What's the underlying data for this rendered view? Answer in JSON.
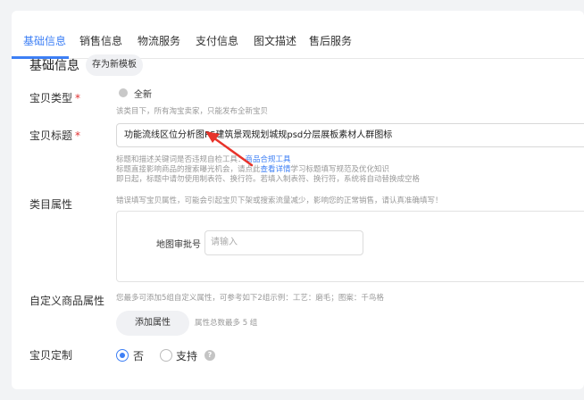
{
  "tabs": [
    {
      "label": "基础信息"
    },
    {
      "label": "销售信息"
    },
    {
      "label": "物流服务"
    },
    {
      "label": "支付信息"
    },
    {
      "label": "图文描述"
    },
    {
      "label": "售后服务"
    }
  ],
  "section": {
    "title": "基础信息",
    "save_template_label": "存为新模板"
  },
  "product_type": {
    "label": "宝贝类型",
    "required_mark": "*",
    "option_label": "全新",
    "tip": "该类目下，所有淘宝卖家，只能发布全新宝贝"
  },
  "product_title": {
    "label": "宝贝标题",
    "required_mark": "*",
    "value": "功能流线区位分析图PS建筑景观规划城规psd分层展板素材人群图标",
    "tip1_prefix": "标题和描述关键词是否违规自检工具：",
    "tip1_link": "商品合规工具",
    "tip2_prefix": "标题直接影响商品的搜索曝光机会，请点此",
    "tip2_link": "查看详情",
    "tip2_suffix": "学习标题填写规范及优化知识",
    "tip3": "即日起，标题中请勿使用制表符、换行符。若填入制表符、换行符，系统将自动替换成空格"
  },
  "category_attrs": {
    "label": "类目属性",
    "tip": "错误填写宝贝属性，可能会引起宝贝下架或搜索流量减少，影响您的正常销售，请认真准确填写！",
    "map_number_label": "地图审批号",
    "map_number_placeholder": "请输入"
  },
  "custom_attrs": {
    "label": "自定义商品属性",
    "tip": "您最多可添加5组自定义属性，可参考如下2组示例：工艺：磨毛；图案：千鸟格",
    "add_button": "添加属性",
    "count_tip": "属性总数最多 5 组"
  },
  "customization": {
    "label": "宝贝定制",
    "options": [
      {
        "label": "否",
        "checked": true
      },
      {
        "label": "支持",
        "checked": false
      }
    ],
    "help_icon": "?"
  },
  "colors": {
    "accent": "#3d7ff5",
    "required": "#e03131",
    "annotation_arrow": "#e8332a"
  }
}
